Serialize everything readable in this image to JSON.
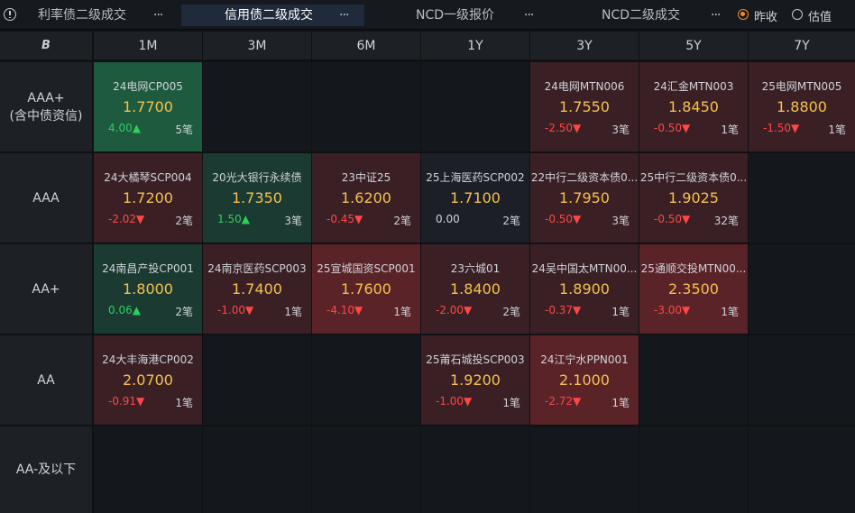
{
  "tabs": [
    {
      "label": "利率债二级成交",
      "more": "···",
      "active": false
    },
    {
      "label": "信用债二级成交",
      "more": "···",
      "active": true
    },
    {
      "label": "NCD一级报价",
      "more": "···",
      "active": false
    },
    {
      "label": "NCD二级成交",
      "more": "···",
      "active": false
    }
  ],
  "options": [
    {
      "label": "昨收",
      "selected": true
    },
    {
      "label": "估值",
      "selected": false
    }
  ],
  "corner_icon": "B",
  "columns": [
    "1M",
    "3M",
    "6M",
    "1Y",
    "3Y",
    "5Y",
    "7Y"
  ],
  "rows": [
    "AAA+\n(含中债资信)",
    "AAA",
    "AA+",
    "AA",
    "AA-及以下"
  ],
  "colors": {
    "green": "#1d5a3e",
    "green_dark": "#1b3a32",
    "red": "#5a2328",
    "red_dark": "#3a2025",
    "neutral": "#1c2026",
    "yield": "#f5c14e",
    "up": "#2fcf5c",
    "down": "#ff4747"
  },
  "cells": [
    {
      "row": 0,
      "col": 0,
      "name": "24电网CP005",
      "yield": "1.7700",
      "change": "4.00▲",
      "count": "5笔",
      "dir": "up",
      "tone": "green"
    },
    {
      "row": 0,
      "col": 4,
      "name": "24电网MTN006",
      "yield": "1.7550",
      "change": "-2.50▼",
      "count": "3笔",
      "dir": "down",
      "tone": "red_dark"
    },
    {
      "row": 0,
      "col": 5,
      "name": "24汇金MTN003",
      "yield": "1.8450",
      "change": "-0.50▼",
      "count": "1笔",
      "dir": "down",
      "tone": "red_dark"
    },
    {
      "row": 0,
      "col": 6,
      "name": "25电网MTN005",
      "yield": "1.8800",
      "change": "-1.50▼",
      "count": "1笔",
      "dir": "down",
      "tone": "red_dark"
    },
    {
      "row": 1,
      "col": 0,
      "name": "24大橘琴SCP004",
      "yield": "1.7200",
      "change": "-2.02▼",
      "count": "2笔",
      "dir": "down",
      "tone": "red_dark"
    },
    {
      "row": 1,
      "col": 1,
      "name": "20光大银行永续债",
      "yield": "1.7350",
      "change": "1.50▲",
      "count": "3笔",
      "dir": "up",
      "tone": "green_dark"
    },
    {
      "row": 1,
      "col": 2,
      "name": "23中证25",
      "yield": "1.6200",
      "change": "-0.45▼",
      "count": "2笔",
      "dir": "down",
      "tone": "red_dark"
    },
    {
      "row": 1,
      "col": 3,
      "name": "25上海医药SCP002",
      "yield": "1.7100",
      "change": "0.00",
      "count": "2笔",
      "dir": "flat",
      "tone": "neutral"
    },
    {
      "row": 1,
      "col": 4,
      "name": "22中行二级资本债0...",
      "yield": "1.7950",
      "change": "-0.50▼",
      "count": "3笔",
      "dir": "down",
      "tone": "red_dark"
    },
    {
      "row": 1,
      "col": 5,
      "name": "25中行二级资本债0...",
      "yield": "1.9025",
      "change": "-0.50▼",
      "count": "32笔",
      "dir": "down",
      "tone": "red_dark"
    },
    {
      "row": 2,
      "col": 0,
      "name": "24南昌产投CP001",
      "yield": "1.8000",
      "change": "0.06▲",
      "count": "2笔",
      "dir": "up",
      "tone": "green_dark"
    },
    {
      "row": 2,
      "col": 1,
      "name": "24南京医药SCP003",
      "yield": "1.7400",
      "change": "-1.00▼",
      "count": "1笔",
      "dir": "down",
      "tone": "red_dark"
    },
    {
      "row": 2,
      "col": 2,
      "name": "25宣城国资SCP001",
      "yield": "1.7600",
      "change": "-4.10▼",
      "count": "1笔",
      "dir": "down",
      "tone": "red"
    },
    {
      "row": 2,
      "col": 3,
      "name": "23六城01",
      "yield": "1.8400",
      "change": "-2.00▼",
      "count": "2笔",
      "dir": "down",
      "tone": "red_dark"
    },
    {
      "row": 2,
      "col": 4,
      "name": "24吴中国太MTN00...",
      "yield": "1.8900",
      "change": "-0.37▼",
      "count": "1笔",
      "dir": "down",
      "tone": "red_dark"
    },
    {
      "row": 2,
      "col": 5,
      "name": "25通顺交投MTN00...",
      "yield": "2.3500",
      "change": "-3.00▼",
      "count": "1笔",
      "dir": "down",
      "tone": "red"
    },
    {
      "row": 3,
      "col": 0,
      "name": "24大丰海港CP002",
      "yield": "2.0700",
      "change": "-0.91▼",
      "count": "1笔",
      "dir": "down",
      "tone": "red_dark"
    },
    {
      "row": 3,
      "col": 3,
      "name": "25莆石城投SCP003",
      "yield": "1.9200",
      "change": "-1.00▼",
      "count": "1笔",
      "dir": "down",
      "tone": "red_dark"
    },
    {
      "row": 3,
      "col": 4,
      "name": "24江宁水PPN001",
      "yield": "2.1000",
      "change": "-2.72▼",
      "count": "1笔",
      "dir": "down",
      "tone": "red"
    }
  ]
}
